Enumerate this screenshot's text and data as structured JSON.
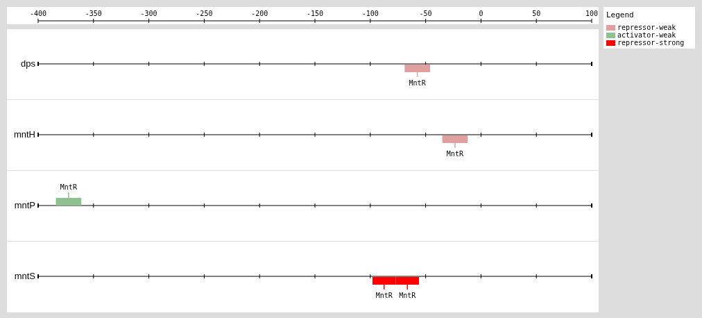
{
  "axis": {
    "ticks": [
      "-400",
      "-350",
      "-300",
      "-250",
      "-200",
      "-150",
      "-100",
      "-50",
      "0",
      "50",
      "100"
    ]
  },
  "tracks": [
    {
      "name": "dps",
      "sites": [
        {
          "label": "MntR",
          "color": "#e0a0a0",
          "above": false
        }
      ]
    },
    {
      "name": "mntH",
      "sites": [
        {
          "label": "MntR",
          "color": "#e0a0a0",
          "above": false
        }
      ]
    },
    {
      "name": "mntP",
      "sites": [
        {
          "label": "MntR",
          "color": "#8fc08f",
          "above": true
        }
      ]
    },
    {
      "name": "mntS",
      "sites": [
        {
          "label": "MntR",
          "color": "#ff0000",
          "above": false
        },
        {
          "label": "MntR",
          "color": "#ff0000",
          "above": false
        }
      ]
    }
  ],
  "legend": {
    "title": "Legend",
    "items": [
      {
        "name": "repressor-weak",
        "color": "#e0a0a0"
      },
      {
        "name": "activator-weak",
        "color": "#8fc08f"
      },
      {
        "name": "repressor-strong",
        "color": "#ff0000"
      }
    ]
  }
}
